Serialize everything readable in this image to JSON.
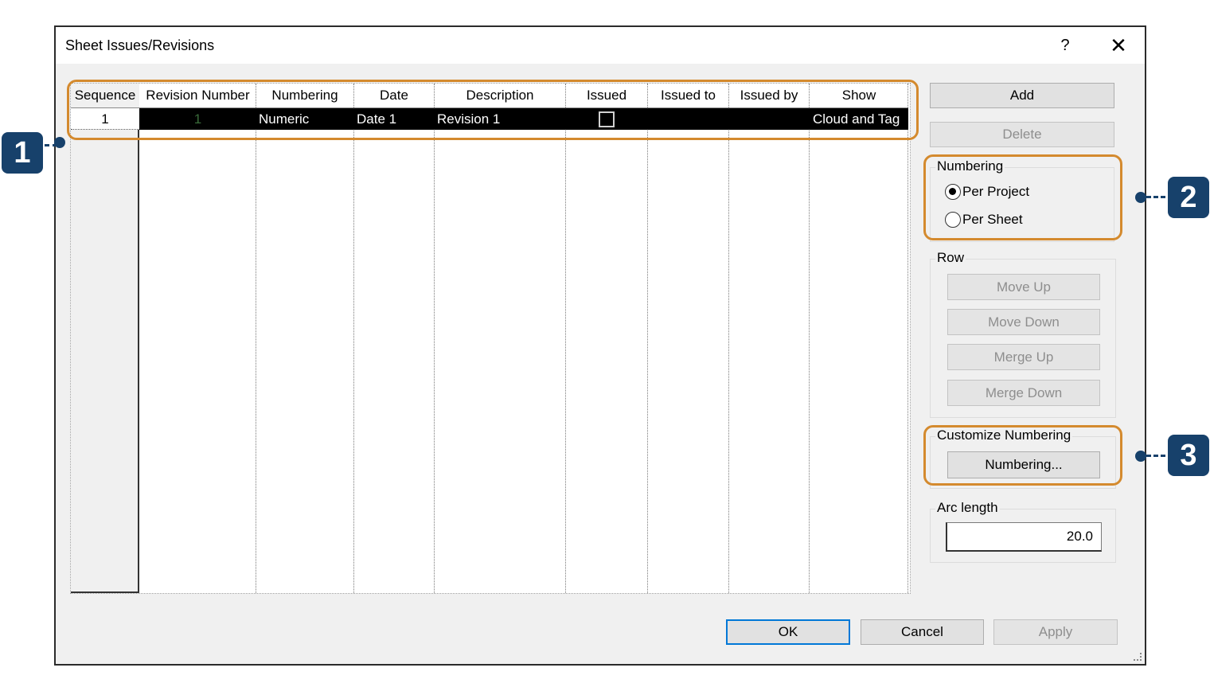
{
  "dialog": {
    "title": "Sheet Issues/Revisions",
    "help": "?",
    "close": "✕"
  },
  "table": {
    "headers": [
      "Sequence",
      "Revision Number",
      "Numbering",
      "Date",
      "Description",
      "Issued",
      "Issued to",
      "Issued by",
      "Show"
    ],
    "rows": [
      {
        "sequence": "1",
        "revision_number": "1",
        "numbering": "Numeric",
        "date": "Date 1",
        "description": "Revision 1",
        "issued": false,
        "issued_to": "",
        "issued_by": "",
        "show": "Cloud and Tag"
      }
    ]
  },
  "side": {
    "add": "Add",
    "delete": "Delete",
    "numbering_group": "Numbering",
    "per_project": "Per Project",
    "per_sheet": "Per Sheet",
    "numbering_selected": "Per Project",
    "row_group": "Row",
    "move_up": "Move Up",
    "move_down": "Move Down",
    "merge_up": "Merge Up",
    "merge_down": "Merge Down",
    "customize_group": "Customize Numbering",
    "numbering_btn": "Numbering...",
    "arc_group": "Arc length",
    "arc_value": "20.0"
  },
  "footer": {
    "ok": "OK",
    "cancel": "Cancel",
    "apply": "Apply"
  },
  "callouts": [
    "1",
    "2",
    "3"
  ],
  "colors": {
    "highlight": "#d48a2e",
    "badge": "#17416b",
    "ok_border": "#0078d7"
  }
}
